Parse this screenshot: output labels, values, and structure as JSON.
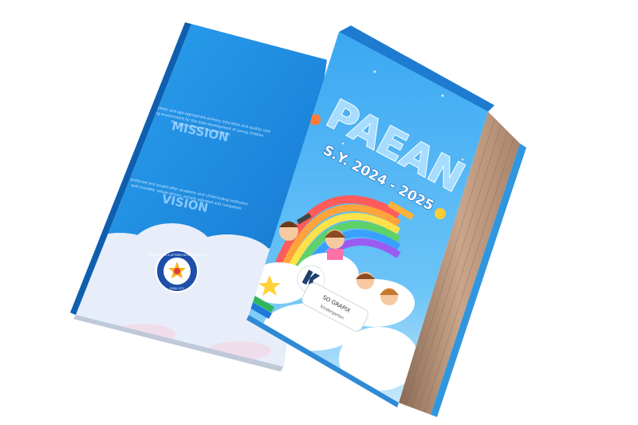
{
  "back_book": {
    "mission_heading": "MISSION",
    "mission_text_1": "To provide holistic and age-appropriate primary education and quality care",
    "mission_text_2": "to a caring environment for the total development of young children",
    "mission_text_3": "The core values of the institution.",
    "vision_heading": "VISION",
    "vision_text_1": "A preferred and sought-after academic and childminding institution",
    "vision_text_2": "well-rounded, values-driven, socially adjusted and competent",
    "seal_text_top": "KIDS DAYCARE & AFTERSCHOOL CENTER INC",
    "seal_text_bottom": "CEBU CITY",
    "colors": {
      "cover": "#1e8ae0",
      "cover_dark": "#0d63b8",
      "cloud": "#e9eef8"
    }
  },
  "front_book": {
    "title": "PAEAN",
    "school_year": "S.Y. 2024 - 2025",
    "name_plate_title": "SO GRAPIX",
    "name_plate_subtitle": "Kindergarten",
    "logo_icon": "stylized-monogram-logo-icon",
    "colors": {
      "sky": "#2c9ae8",
      "title": "#9cd8ff",
      "spine": "#3aa0e6",
      "pages": "#c9a58a"
    }
  }
}
